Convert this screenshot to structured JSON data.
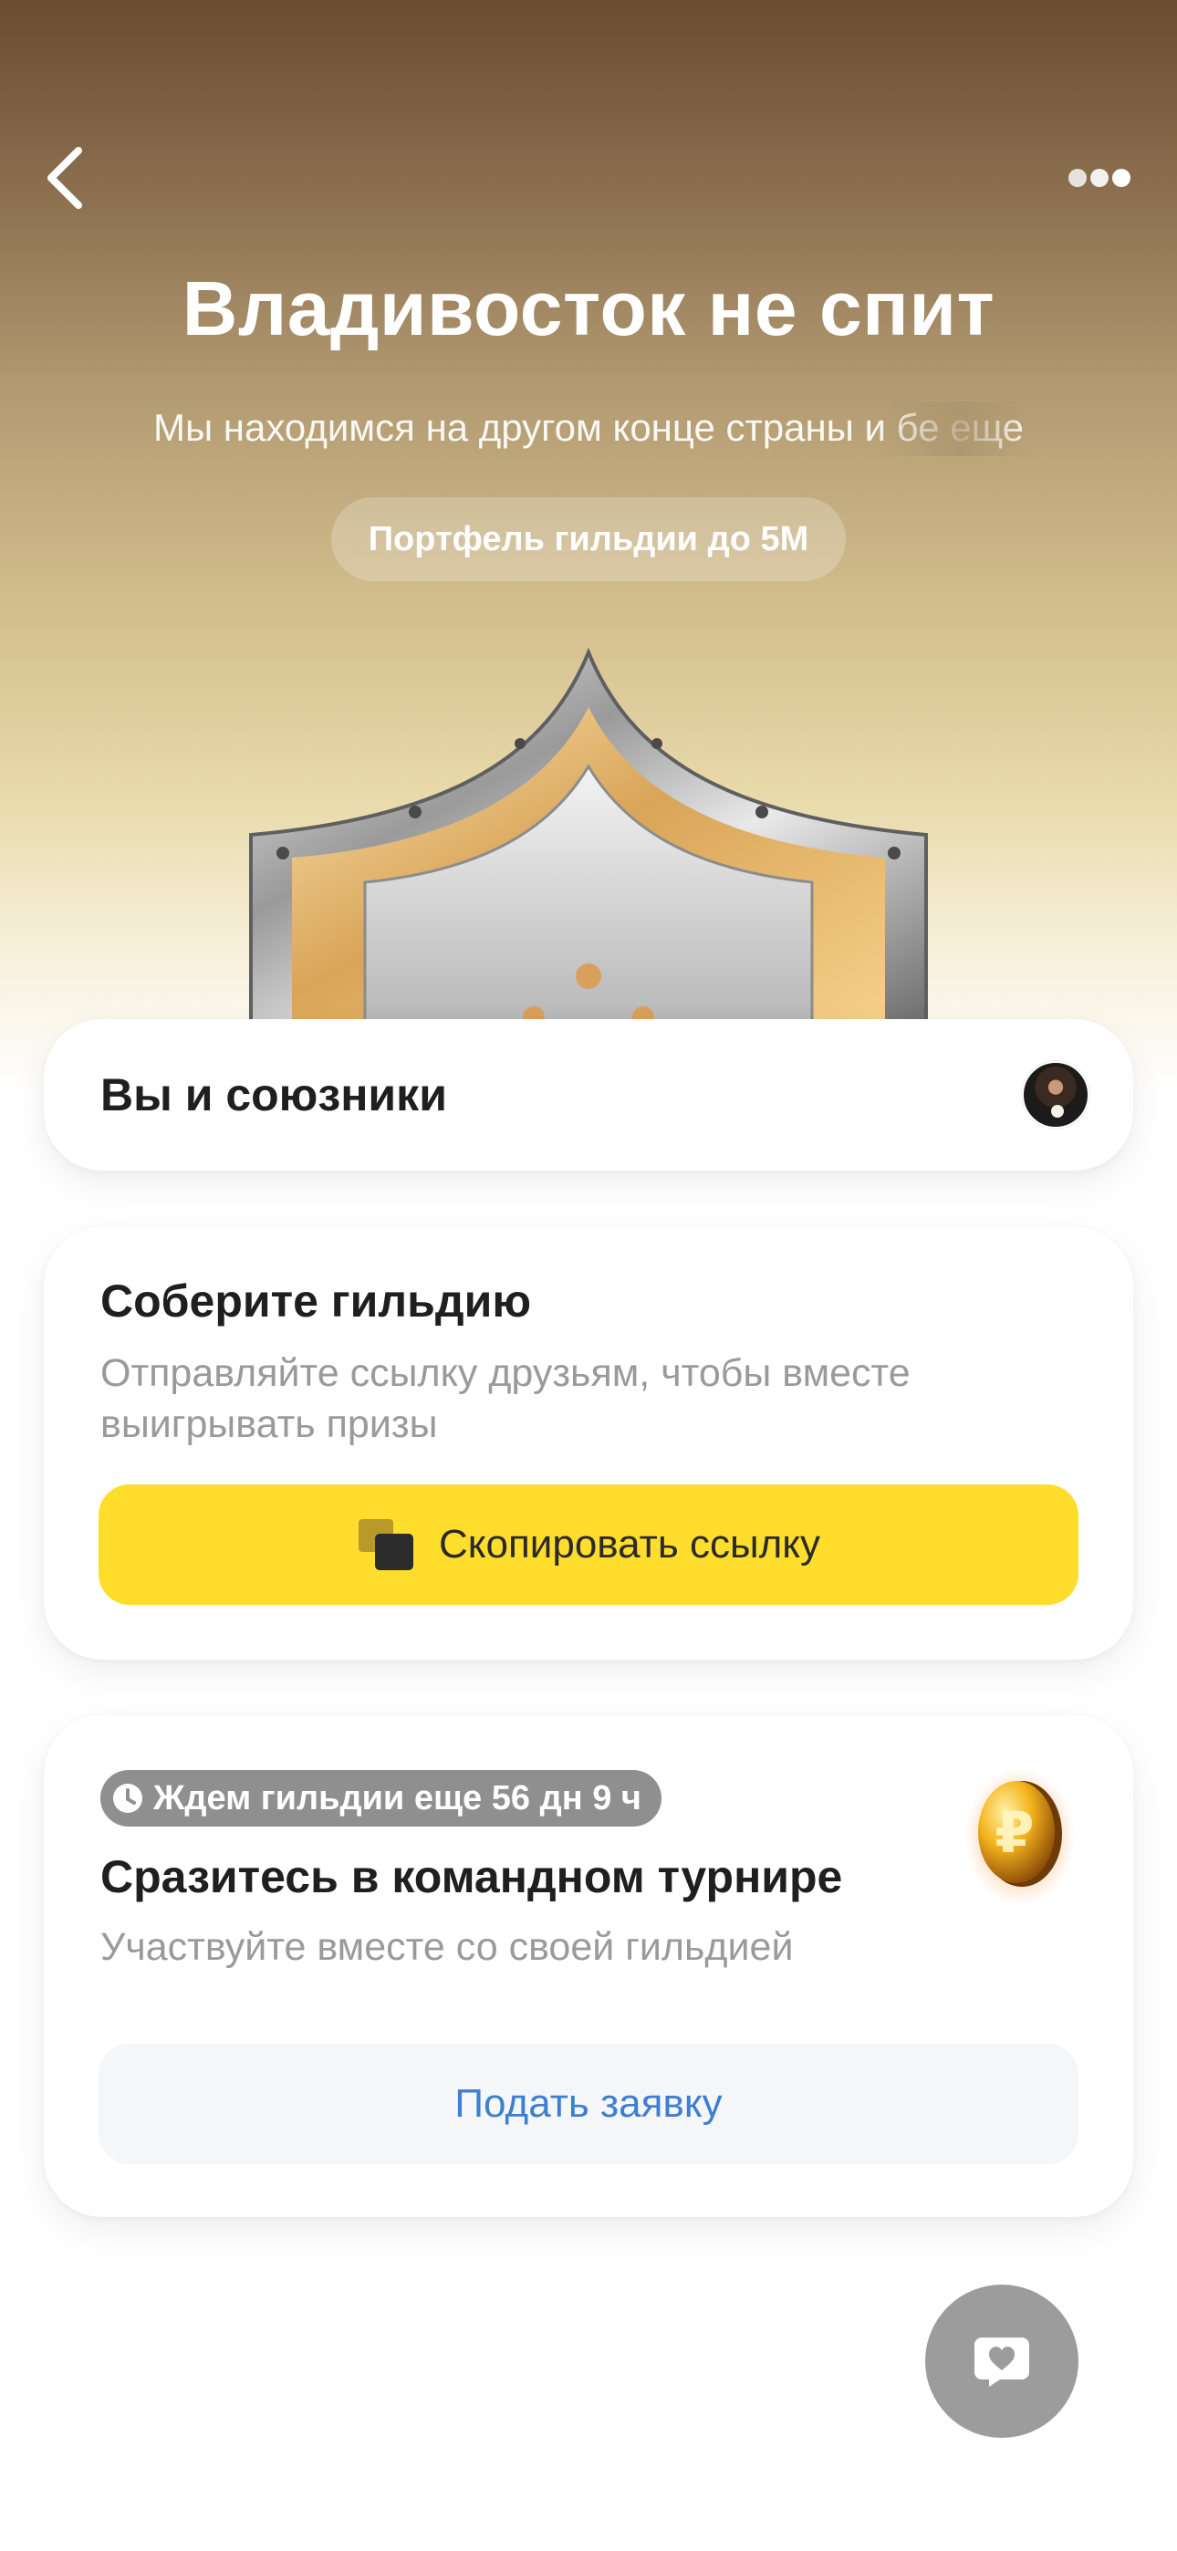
{
  "header": {
    "back_icon": "chevron-left-icon",
    "more_icon": "more-dots-icon",
    "title": "Владивосток не спит",
    "subtitle": "Мы находимся на другом конце страны и бе еще",
    "portfolio_pill": "Портфель гильдии до 5М",
    "hero_image": "silver-gold-shield-with-crown"
  },
  "allies": {
    "label": "Вы и союзники",
    "avatar_icon": "user-avatar"
  },
  "guild": {
    "title": "Соберите гильдию",
    "description": "Отправляйте ссылку друзьям, чтобы вместе выигрывать призы",
    "copy_button_label": "Скопировать ссылку",
    "copy_icon": "copy-icon"
  },
  "tournament": {
    "timer_label": "Ждем гильдии еще 56 дн 9 ч",
    "timer_icon": "clock-icon",
    "title": "Сразитесь в командном турнире",
    "description": "Участвуйте вместе со своей гильдией",
    "apply_button_label": "Подать заявку",
    "coin_icon": "gold-ruble-coin-icon"
  },
  "fab": {
    "icon": "chat-heart-icon"
  },
  "colors": {
    "accent_yellow": "#ffdd2d",
    "link_blue": "#3d7fd0",
    "badge_gray": "#8f8f8f",
    "hero_top": "#6a4c2f"
  }
}
